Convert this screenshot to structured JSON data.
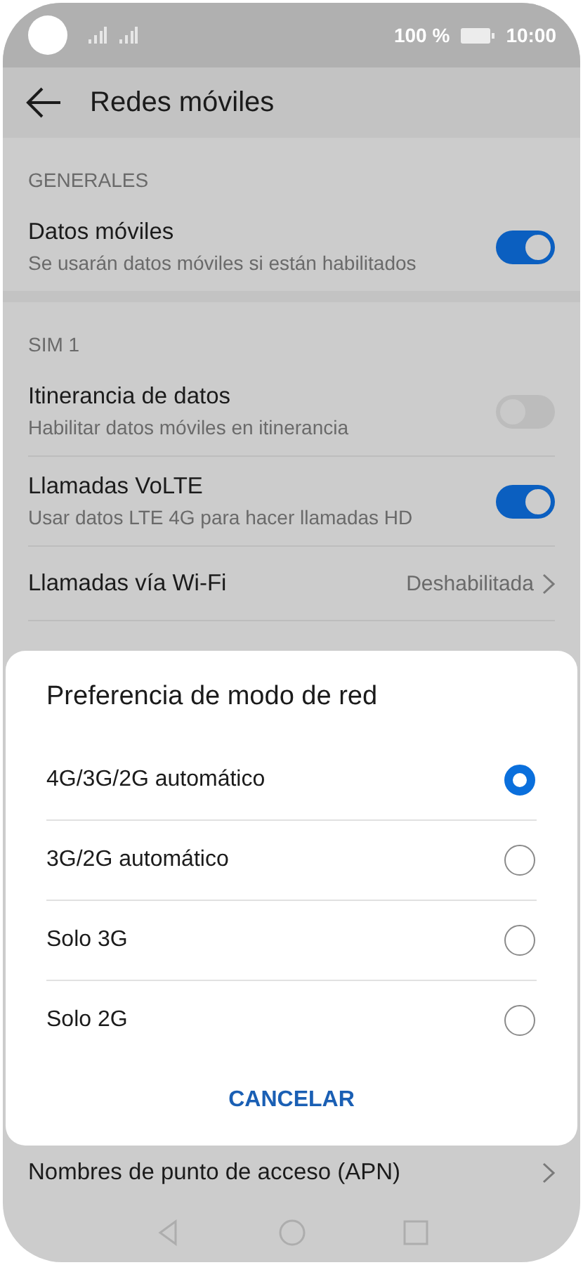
{
  "status_bar": {
    "battery": "100 %",
    "time": "10:00"
  },
  "toolbar": {
    "title": "Redes móviles"
  },
  "sections": [
    {
      "header": "GENERALES",
      "items": [
        {
          "kind": "toggle",
          "title": "Datos móviles",
          "subtitle": "Se usarán datos móviles si están habilitados",
          "on": true
        }
      ]
    },
    {
      "header": "SIM 1",
      "items": [
        {
          "kind": "toggle",
          "title": "Itinerancia de datos",
          "subtitle": "Habilitar datos móviles en itinerancia",
          "on": false
        },
        {
          "kind": "toggle",
          "title": "Llamadas VoLTE",
          "subtitle": "Usar datos LTE 4G para hacer llamadas HD",
          "on": true
        },
        {
          "kind": "link",
          "title": "Llamadas vía Wi-Fi",
          "value": "Deshabilitada"
        }
      ]
    }
  ],
  "bottom_items": [
    {
      "kind": "link",
      "title": "Nombres de punto de acceso (APN)"
    }
  ],
  "dialog": {
    "title": "Preferencia de modo de red",
    "options": [
      {
        "label": "4G/3G/2G automático",
        "selected": true
      },
      {
        "label": "3G/2G automático",
        "selected": false
      },
      {
        "label": "Solo 3G",
        "selected": false
      },
      {
        "label": "Solo 2G",
        "selected": false
      }
    ],
    "buttons": [
      "CANCELAR"
    ]
  }
}
